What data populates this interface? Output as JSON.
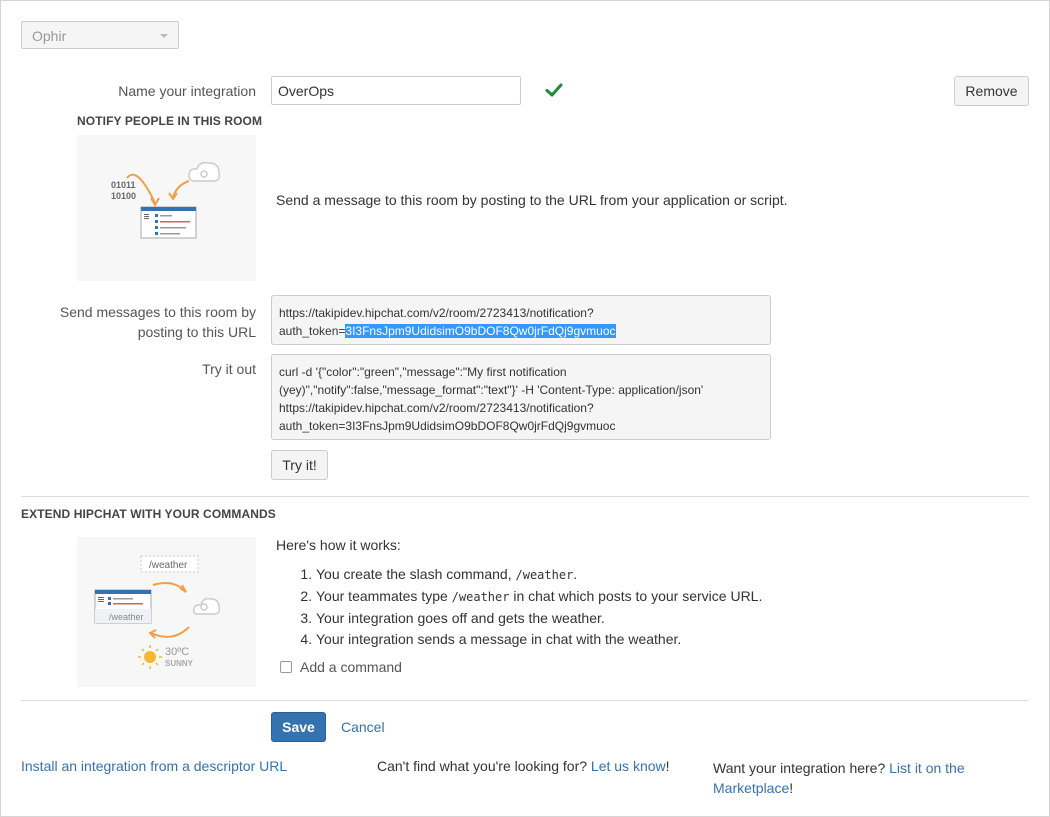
{
  "room_select": {
    "value": "Ophir"
  },
  "integration": {
    "name_label": "Name your integration",
    "name_value": "OverOps",
    "remove_label": "Remove"
  },
  "notify": {
    "title": "NOTIFY PEOPLE IN THIS ROOM",
    "illustration_text_1": "01011",
    "illustration_text_2": "10100",
    "description": "Send a message to this room by posting to the URL from your application or script.",
    "url_label_1": "Send messages to this room by",
    "url_label_2": "posting to this URL",
    "url_line1": "https://takipidev.hipchat.com/v2/room/2723413/notification?",
    "url_prefix": "auth_token=",
    "url_token": "3I3FnsJpm9UdidsimO9bDOF8Qw0jrFdQj9gvmuoc",
    "try_label": "Try it out",
    "try_line1": "curl -d '{\"color\":\"green\",\"message\":\"My first notification",
    "try_line2": "(yey)\",\"notify\":false,\"message_format\":\"text\"}' -H 'Content-Type: application/json'",
    "try_line3": "https://takipidev.hipchat.com/v2/room/2723413/notification?",
    "try_line4": "auth_token=3I3FnsJpm9UdidsimO9bDOF8Qw0jrFdQj9gvmuoc",
    "try_button": "Try it!"
  },
  "extend": {
    "title": "EXTEND HIPCHAT WITH YOUR COMMANDS",
    "illustration_cmd": "/weather",
    "illustration_cmd2": "/weather",
    "illustration_temp": "30ºC",
    "illustration_cond": "SUNNY",
    "how_label": "Here's how it works:",
    "steps": [
      {
        "pre": "You create the slash command, ",
        "code": "/weather",
        "post": "."
      },
      {
        "pre": "Your teammates type ",
        "code": "/weather",
        "post": " in chat which posts to your service URL."
      },
      {
        "pre": "Your integration goes off and gets the weather.",
        "code": "",
        "post": ""
      },
      {
        "pre": "Your integration sends a message in chat with the weather.",
        "code": "",
        "post": ""
      }
    ],
    "add_command_label": "Add a command"
  },
  "actions": {
    "save": "Save",
    "cancel": "Cancel"
  },
  "footer": {
    "install_link": "Install an integration from a descriptor URL",
    "cant_find": "Can't find what you're looking for? ",
    "let_us_know": "Let us know",
    "excl1": "!",
    "want_here": "Want your integration here? ",
    "list_it": "List it on the",
    "marketplace": "Marketplace",
    "excl2": "!"
  },
  "colors": {
    "accent": "#3572b0",
    "success": "#1e8a3b",
    "orange": "#f0a04b"
  }
}
